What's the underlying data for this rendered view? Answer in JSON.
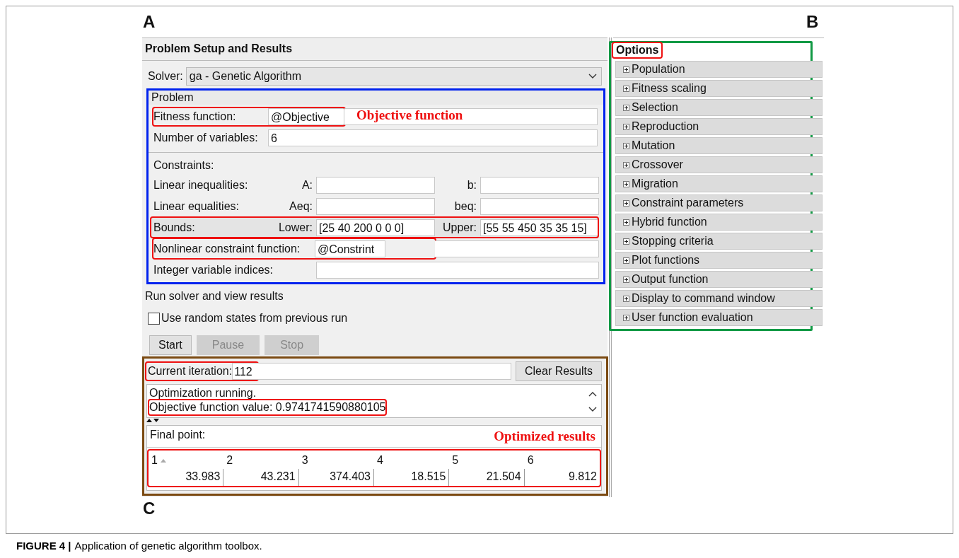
{
  "panel_labels": [
    "A",
    "B",
    "C"
  ],
  "problem_setup": {
    "title": "Problem Setup and Results",
    "solver": {
      "label": "Solver:",
      "value": "ga - Genetic Algorithm"
    },
    "problem": {
      "heading": "Problem",
      "fitness": {
        "label": "Fitness function:",
        "value": "@Objective",
        "highlighted": true,
        "annotation": "Objective function"
      },
      "variables": {
        "label": "Number of variables:",
        "value": "6",
        "highlighted": false
      },
      "constraints_heading": "Constraints:",
      "constraint_rows": [
        {
          "kind": "pair",
          "label": "Linear inequalities:",
          "fields": [
            {
              "label": "A:"
            },
            {
              "label": "b:"
            }
          ],
          "highlighted": false
        },
        {
          "kind": "pair",
          "label": "Linear equalities:",
          "fields": [
            {
              "label": "Aeq:"
            },
            {
              "label": "beq:"
            }
          ],
          "highlighted": false
        },
        {
          "kind": "pair",
          "label": "Bounds:",
          "fields": [
            {
              "label": "Lower:",
              "value": "[25 40 200 0 0 0]"
            },
            {
              "label": "Upper:",
              "value": "[55 55 450 35 35 15]"
            }
          ],
          "highlighted": true
        },
        {
          "kind": "single",
          "label": "Nonlinear constraint function:",
          "value": "@Constrint",
          "highlighted": true
        },
        {
          "kind": "single",
          "label": "Integer variable indices:",
          "highlighted": false
        }
      ]
    },
    "run": {
      "heading": "Run solver and view results",
      "random_states": {
        "label": "Use random states from previous run",
        "checked": false
      },
      "buttons": [
        {
          "label": "Start",
          "disabled": false
        },
        {
          "label": "Pause",
          "disabled": true
        },
        {
          "label": "Stop",
          "disabled": true
        }
      ]
    },
    "results": {
      "iteration": {
        "label": "Current iteration:",
        "value": "112",
        "highlighted": true
      },
      "clear_button": "Clear Results",
      "log": [
        {
          "text": "Optimization running.",
          "highlighted": false
        },
        {
          "text": "Objective function value: 0.9741741590880105",
          "highlighted": true
        }
      ],
      "final_point": {
        "label": "Final point:",
        "annotation": "Optimized results",
        "highlighted": true,
        "columns": [
          "1",
          "2",
          "3",
          "4",
          "5",
          "6"
        ],
        "values": [
          "33.983",
          "43.231",
          "374.403",
          "18.515",
          "21.504",
          "9.812"
        ]
      }
    }
  },
  "options": {
    "title": "Options",
    "title_highlighted": true,
    "sections": [
      {
        "label": "Population",
        "expanded": false
      },
      {
        "label": "Fitness scaling",
        "expanded": false
      },
      {
        "label": "Selection",
        "expanded": false
      },
      {
        "label": "Reproduction",
        "expanded": false
      },
      {
        "label": "Mutation",
        "expanded": false
      },
      {
        "label": "Crossover",
        "expanded": false
      },
      {
        "label": "Migration",
        "expanded": false
      },
      {
        "label": "Constraint parameters",
        "expanded": false
      },
      {
        "label": "Hybrid function",
        "expanded": false
      },
      {
        "label": "Stopping criteria",
        "expanded": false
      },
      {
        "label": "Plot functions",
        "expanded": false
      },
      {
        "label": "Output function",
        "expanded": false
      },
      {
        "label": "Display to command window",
        "expanded": false
      },
      {
        "label": "User function evaluation",
        "expanded": false
      }
    ]
  },
  "caption": {
    "label": "FIGURE 4 |",
    "text": "Application of genetic algorithm toolbox."
  }
}
